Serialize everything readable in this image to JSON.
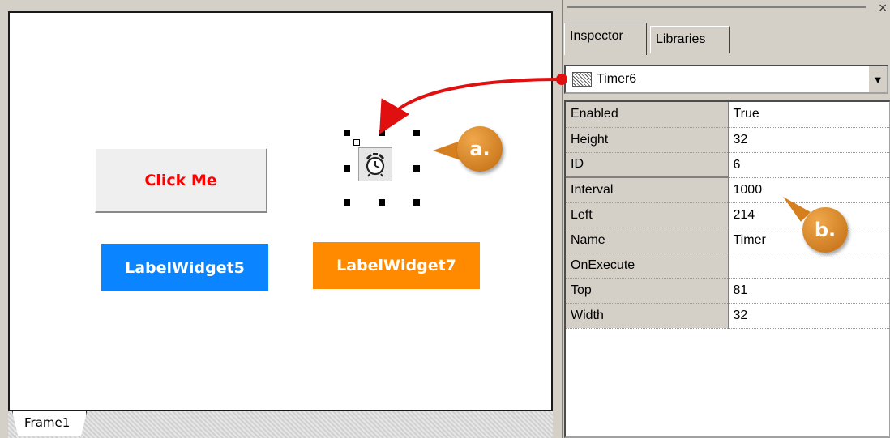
{
  "frame": {
    "tab_label": "Frame1",
    "button_label": "Click Me",
    "label5_text": "LabelWidget5",
    "label7_text": "LabelWidget7",
    "timer_icon": "alarm-clock-icon"
  },
  "inspector": {
    "tabs": [
      {
        "label": "Inspector"
      },
      {
        "label": "Libraries"
      }
    ],
    "selected_object": "Timer6",
    "properties": [
      {
        "name": "Enabled",
        "value": "True"
      },
      {
        "name": "Height",
        "value": "32"
      },
      {
        "name": "ID",
        "value": "6"
      },
      {
        "name": "Interval",
        "value": "1000"
      },
      {
        "name": "Left",
        "value": "214"
      },
      {
        "name": "Name",
        "value": "Timer"
      },
      {
        "name": "OnExecute",
        "value": ""
      },
      {
        "name": "Top",
        "value": "81"
      },
      {
        "name": "Width",
        "value": "32"
      }
    ]
  },
  "callouts": {
    "a": "a.",
    "b": "b."
  },
  "colors": {
    "button_text": "#ff0000",
    "label5_bg": "#0a84ff",
    "label7_bg": "#ff8a00",
    "callout": "#d67f1f",
    "arrow": "#e01010"
  }
}
